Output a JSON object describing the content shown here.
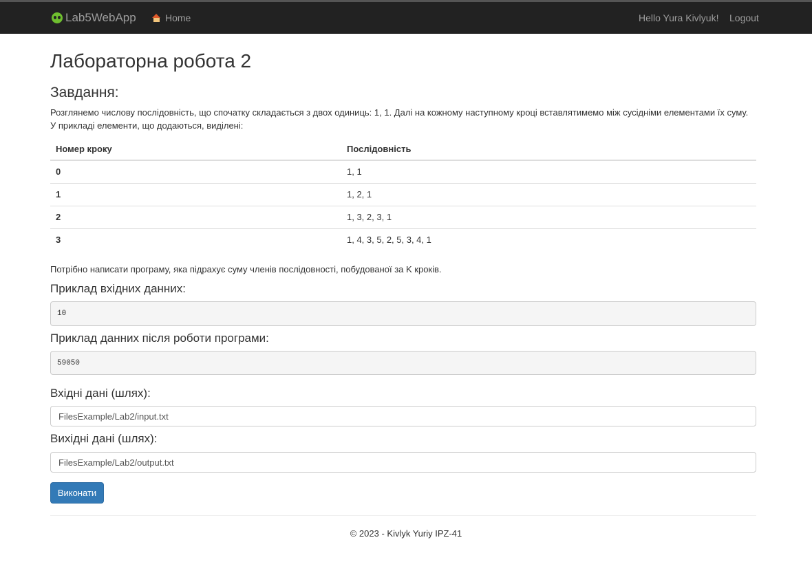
{
  "navbar": {
    "brand": "Lab5WebApp",
    "home": "Home",
    "greeting": "Hello Yura Kivlyuk!",
    "logout": "Logout"
  },
  "page": {
    "title": "Лабораторна робота 2",
    "task_heading": "Завдання:",
    "task_text": "Розглянемо числову послідовність, що спочатку складається з двох одиниць: 1, 1. Далі на кожному наступному кроці вставлятимемо між сусідніми елементами їх суму. У прикладі елементи, що додаються, виділені:",
    "table": {
      "headers": [
        "Номер кроку",
        "Послідовність"
      ],
      "rows": [
        [
          "0",
          "1, 1"
        ],
        [
          "1",
          "1, 2, 1"
        ],
        [
          "2",
          "1, 3, 2, 3, 1"
        ],
        [
          "3",
          "1, 4, 3, 5, 2, 5, 3, 4, 1"
        ]
      ]
    },
    "need_text": "Потрібно написати програму, яка підрахує суму членів послідовності, побудованої за K кроків.",
    "example_input_label": "Приклад вхідних данних:",
    "example_input": "10",
    "example_output_label": "Приклад данних після роботи програми:",
    "example_output": "59050",
    "input_path_label": "Вхідні дані (шлях):",
    "input_path_value": "FilesExample/Lab2/input.txt",
    "output_path_label": "Вихідні дані (шлях):",
    "output_path_value": "FilesExample/Lab2/output.txt",
    "run_button": "Виконати"
  },
  "footer": {
    "text": "© 2023 - Kivlyk Yuriy IPZ-41"
  }
}
